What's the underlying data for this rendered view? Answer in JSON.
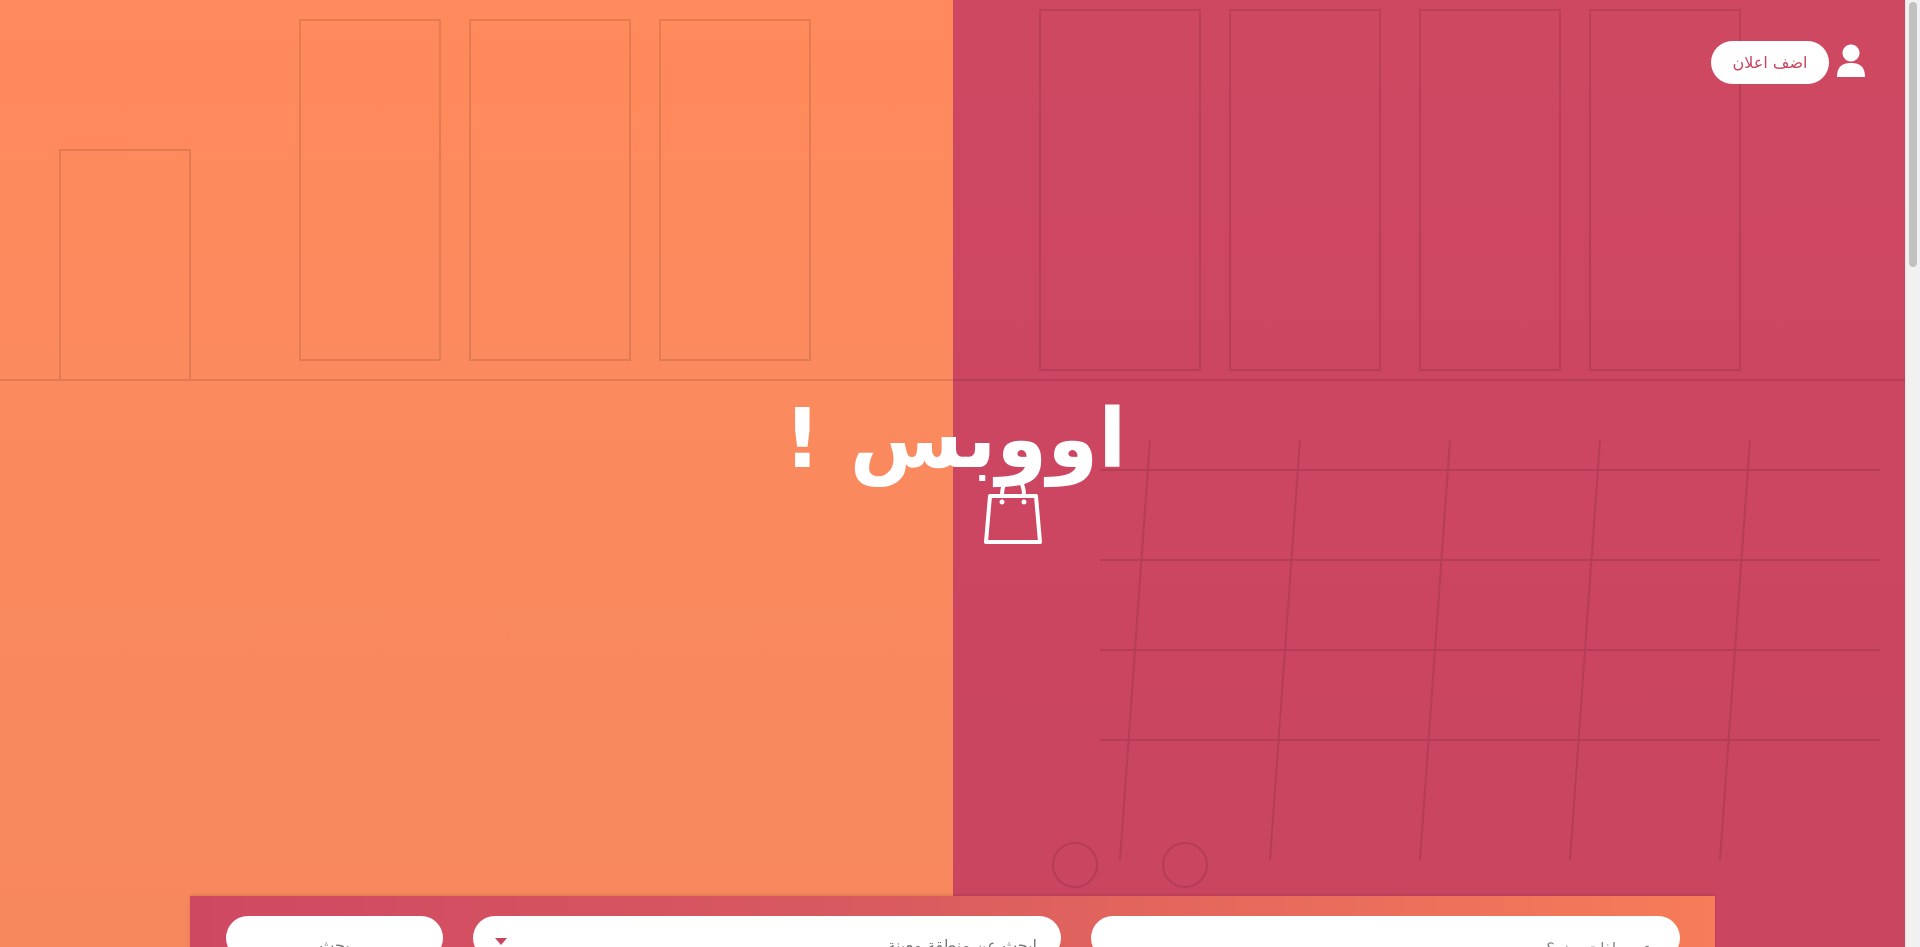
{
  "header": {
    "add_ad_label": "اضف اعلان",
    "user_icon": "user-icon"
  },
  "hero": {
    "title": "اووبس !",
    "bag_icon": "shopping-bag-icon",
    "colors": {
      "left_panel": "#fb8a5e",
      "right_panel": "#cc4561"
    }
  },
  "search": {
    "keyword_placeholder": "عن ماذا تبحث ؟",
    "region_label": "ابحث عن منطقة معينة",
    "submit_label": "بحث",
    "dropdown_icon": "caret-down-icon"
  }
}
